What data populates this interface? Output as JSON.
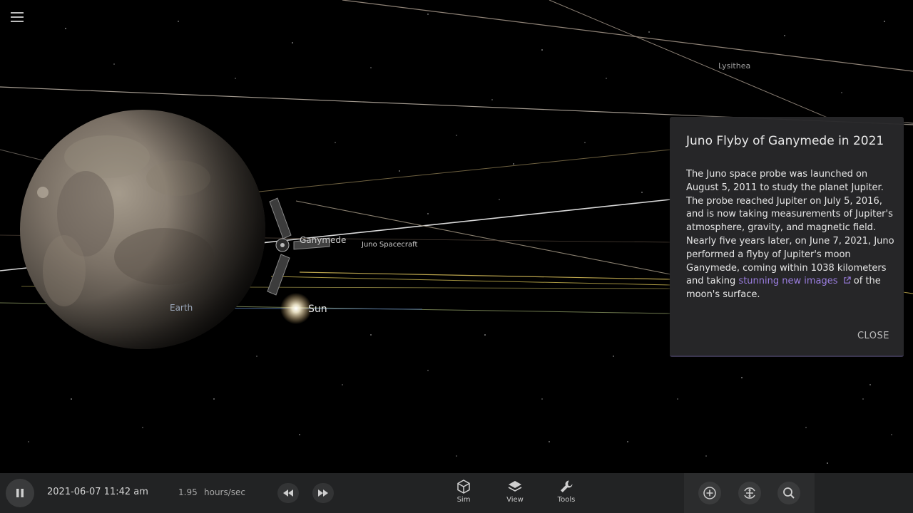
{
  "app": {
    "menu_icon": "hamburger-icon"
  },
  "scene": {
    "labels": {
      "lysithea": "Lysithea",
      "ganymede": "Ganymede",
      "juno": "Juno Spacecraft",
      "earth": "Earth",
      "sun": "Sun"
    }
  },
  "info": {
    "title": "Juno Flyby of Ganymede in 2021",
    "body": "The Juno space probe was launched on August 5, 2011 to study the planet Jupiter. The probe reached Jupiter on July 5, 2016, and is now taking measurements of Jupiter's atmosphere, gravity, and magnetic field. Nearly five years later, on June 7, 2021, Juno performed a flyby of Jupiter's moon Ganymede, coming within 1038 kilometers and taking ",
    "link_text": "stunning new images",
    "body_end": " of the moon's surface.",
    "close_label": "CLOSE",
    "link_color": "#9b7ee0"
  },
  "bottom_bar": {
    "play_state_icon": "pause-icon",
    "date": "2021-06-07 11:42 am",
    "rate_value": "1.95",
    "rate_unit": "hours/sec",
    "nav": {
      "sim": "Sim",
      "view": "View",
      "tools": "Tools"
    },
    "right_icons": [
      "zoom-in-icon",
      "recenter-icon",
      "search-icon"
    ]
  }
}
